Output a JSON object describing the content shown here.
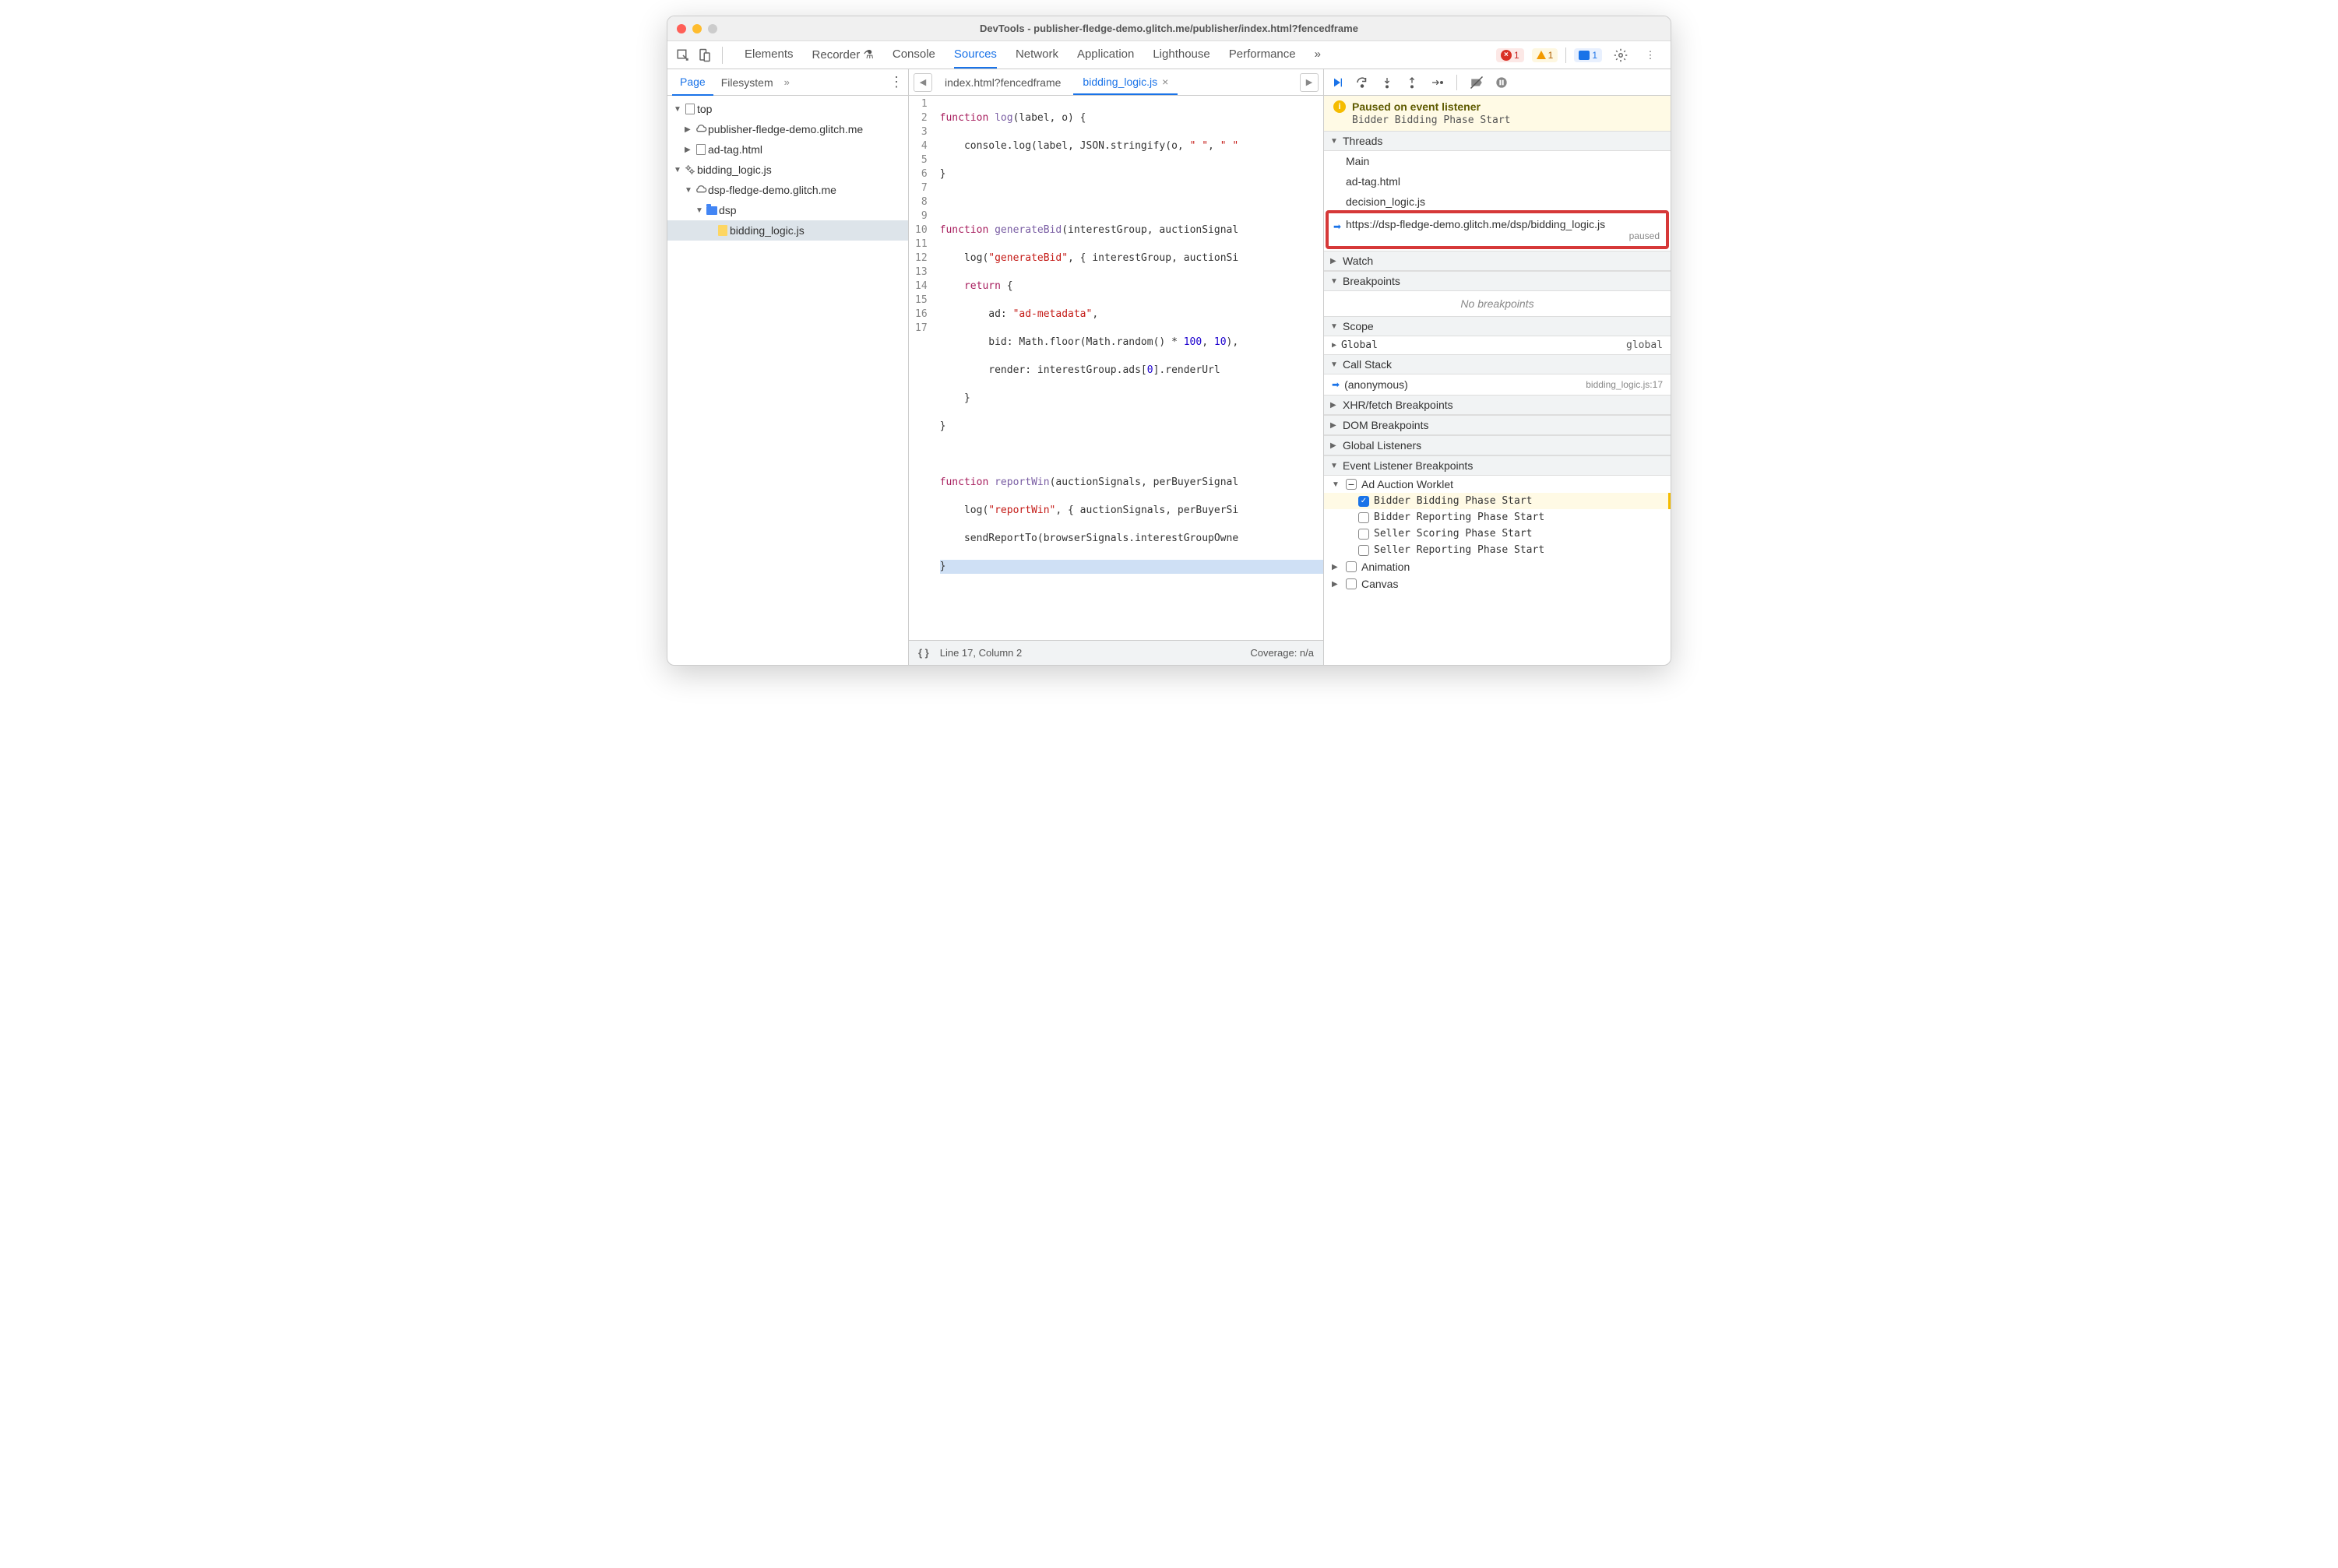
{
  "window": {
    "title": "DevTools - publisher-fledge-demo.glitch.me/publisher/index.html?fencedframe"
  },
  "toolbar": {
    "tabs": [
      "Elements",
      "Recorder",
      "Console",
      "Sources",
      "Network",
      "Application",
      "Lighthouse",
      "Performance"
    ],
    "active": "Sources",
    "error_count": "1",
    "warning_count": "1",
    "message_count": "1"
  },
  "left": {
    "tabs": [
      "Page",
      "Filesystem"
    ],
    "active": "Page",
    "tree": {
      "top": "top",
      "pub_domain": "publisher-fledge-demo.glitch.me",
      "ad_tag": "ad-tag.html",
      "bidding_worklet": "bidding_logic.js",
      "dsp_domain": "dsp-fledge-demo.glitch.me",
      "dsp_folder": "dsp",
      "dsp_file": "bidding_logic.js"
    }
  },
  "editor": {
    "tabs": [
      {
        "label": "index.html?fencedframe",
        "active": false
      },
      {
        "label": "bidding_logic.js",
        "active": true
      }
    ],
    "lines": [
      "function log(label, o) {",
      "    console.log(label, JSON.stringify(o, \" \", \" \"",
      "}",
      "",
      "function generateBid(interestGroup, auctionSignal",
      "    log(\"generateBid\", { interestGroup, auctionSi",
      "    return {",
      "        ad: \"ad-metadata\",",
      "        bid: Math.floor(Math.random() * 100, 10),",
      "        render: interestGroup.ads[0].renderUrl",
      "    }",
      "}",
      "",
      "function reportWin(auctionSignals, perBuyerSignal",
      "    log(\"reportWin\", { auctionSignals, perBuyerSi",
      "    sendReportTo(browserSignals.interestGroupOwne",
      "}"
    ],
    "status": {
      "position": "Line 17, Column 2",
      "coverage": "Coverage: n/a"
    }
  },
  "debug": {
    "paused_title": "Paused on event listener",
    "paused_detail": "Bidder Bidding Phase Start",
    "sections": {
      "threads": "Threads",
      "watch": "Watch",
      "breakpoints": "Breakpoints",
      "scope": "Scope",
      "callstack": "Call Stack",
      "xhr": "XHR/fetch Breakpoints",
      "dom": "DOM Breakpoints",
      "global": "Global Listeners",
      "elb": "Event Listener Breakpoints"
    },
    "threads": [
      "Main",
      "ad-tag.html",
      "decision_logic.js"
    ],
    "thread_highlighted": {
      "url": "https://dsp-fledge-demo.glitch.me/dsp/bidding_logic.js",
      "status": "paused"
    },
    "no_breakpoints": "No breakpoints",
    "scope_global": "Global",
    "scope_global_val": "global",
    "callstack": {
      "fn": "(anonymous)",
      "loc": "bidding_logic.js:17"
    },
    "elb": {
      "category": "Ad Auction Worklet",
      "items": [
        {
          "label": "Bidder Bidding Phase Start",
          "checked": true
        },
        {
          "label": "Bidder Reporting Phase Start",
          "checked": false
        },
        {
          "label": "Seller Scoring Phase Start",
          "checked": false
        },
        {
          "label": "Seller Reporting Phase Start",
          "checked": false
        }
      ],
      "animation": "Animation",
      "canvas": "Canvas"
    }
  }
}
